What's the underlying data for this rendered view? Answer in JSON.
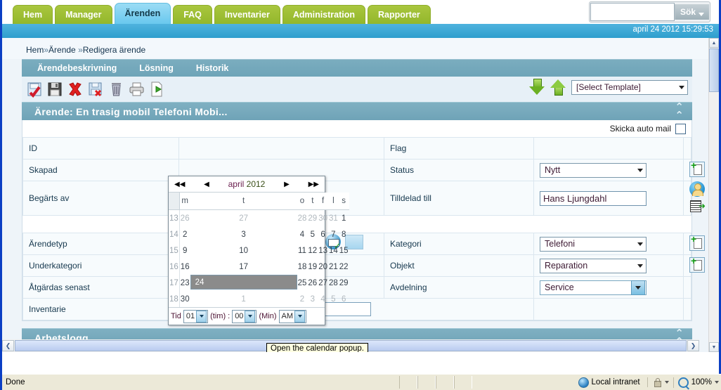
{
  "topnav": {
    "tabs": [
      {
        "label": "Hem",
        "active": false
      },
      {
        "label": "Manager",
        "active": false
      },
      {
        "label": "Ärenden",
        "active": true
      },
      {
        "label": "FAQ",
        "active": false
      },
      {
        "label": "Inventarier",
        "active": false
      },
      {
        "label": "Administration",
        "active": false
      },
      {
        "label": "Rapporter",
        "active": false
      }
    ],
    "search": {
      "value": "",
      "placeholder": "",
      "button_label": "Sök"
    },
    "datetime": "april 24 2012 15:29:53"
  },
  "breadcrumb": {
    "home": "Hem",
    "sep": "»",
    "level2": "Ärende",
    "level3": "Redigera ärende"
  },
  "subtabs": [
    {
      "label": "Ärendebeskrivning"
    },
    {
      "label": "Lösning"
    },
    {
      "label": "Historik"
    }
  ],
  "toolbar": {
    "icons": [
      {
        "name": "save-approve-icon"
      },
      {
        "name": "save-icon"
      },
      {
        "name": "cancel-icon"
      },
      {
        "name": "save-delete-icon"
      },
      {
        "name": "trash-icon"
      },
      {
        "name": "print-icon"
      },
      {
        "name": "run-page-icon"
      }
    ],
    "download_icon": "arrow-down-icon",
    "upload_icon": "arrow-up-icon",
    "template_select": "[Select Template]"
  },
  "case_panel": {
    "title": "Ärende: En trasig mobil Telefoni Mobi...",
    "collapse_icon": "chevron-up-icon",
    "auto_mail_label": "Skicka auto mail",
    "auto_mail_checked": false,
    "rows": [
      {
        "left_label": "ID",
        "left_value": "",
        "right_label": "Flag",
        "right_value": "",
        "right_control": "none"
      },
      {
        "left_label": "Skapad",
        "left_value": "",
        "right_label": "Status",
        "right_value": "Nytt",
        "right_control": "select"
      },
      {
        "left_label": "Begärts av",
        "left_value": "",
        "right_label": "Tilldelad till",
        "right_value": "Hans Ljungdahl",
        "right_control": "text"
      },
      {
        "left_label": "",
        "left_value": "",
        "right_label": "",
        "right_value": "",
        "right_control": "none"
      },
      {
        "left_label": "Ärendetyp",
        "left_value": "",
        "right_label": "Kategori",
        "right_value": "Telefoni",
        "right_control": "select"
      },
      {
        "left_label": "Underkategori",
        "left_value": "",
        "right_label": "Objekt",
        "right_value": "Reparation",
        "right_control": "select"
      },
      {
        "left_label": "Åtgärdas senast",
        "left_value": "",
        "right_label": "Avdelning",
        "right_value": "Service",
        "right_control": "select-blue"
      },
      {
        "left_label": "Inventarie",
        "left_value": "",
        "right_label": "",
        "right_value": "",
        "right_control": "none"
      }
    ]
  },
  "calendar": {
    "nav": {
      "prev_year": "◀◀",
      "prev_month": "◀",
      "next_month": "▶",
      "next_year": "▶▶"
    },
    "month": "april",
    "year": "2012",
    "weekday_headers": [
      "m",
      "t",
      "o",
      "t",
      "f",
      "l",
      "s"
    ],
    "week_numbers": [
      "13",
      "14",
      "15",
      "16",
      "17",
      "18"
    ],
    "weeks": [
      [
        {
          "d": "26",
          "off": true
        },
        {
          "d": "27",
          "off": true
        },
        {
          "d": "28",
          "off": true
        },
        {
          "d": "29",
          "off": true
        },
        {
          "d": "30",
          "off": true
        },
        {
          "d": "31",
          "off": true
        },
        {
          "d": "1",
          "off": false
        }
      ],
      [
        {
          "d": "2",
          "off": false
        },
        {
          "d": "3",
          "off": false
        },
        {
          "d": "4",
          "off": false
        },
        {
          "d": "5",
          "off": false
        },
        {
          "d": "6",
          "off": false
        },
        {
          "d": "7",
          "off": false
        },
        {
          "d": "8",
          "off": false
        }
      ],
      [
        {
          "d": "9",
          "off": false
        },
        {
          "d": "10",
          "off": false
        },
        {
          "d": "11",
          "off": false
        },
        {
          "d": "12",
          "off": false
        },
        {
          "d": "13",
          "off": false
        },
        {
          "d": "14",
          "off": false
        },
        {
          "d": "15",
          "off": false
        }
      ],
      [
        {
          "d": "16",
          "off": false
        },
        {
          "d": "17",
          "off": false
        },
        {
          "d": "18",
          "off": false
        },
        {
          "d": "19",
          "off": false
        },
        {
          "d": "20",
          "off": false
        },
        {
          "d": "21",
          "off": false
        },
        {
          "d": "22",
          "off": false
        }
      ],
      [
        {
          "d": "23",
          "off": false
        },
        {
          "d": "24",
          "off": false,
          "selected": true
        },
        {
          "d": "25",
          "off": false
        },
        {
          "d": "26",
          "off": false
        },
        {
          "d": "27",
          "off": false
        },
        {
          "d": "28",
          "off": false
        },
        {
          "d": "29",
          "off": false
        }
      ],
      [
        {
          "d": "30",
          "off": false
        },
        {
          "d": "1",
          "off": true
        },
        {
          "d": "2",
          "off": true
        },
        {
          "d": "3",
          "off": true
        },
        {
          "d": "4",
          "off": true
        },
        {
          "d": "5",
          "off": true
        },
        {
          "d": "6",
          "off": true
        }
      ]
    ],
    "time": {
      "label": "Tid",
      "hour": "01",
      "hour_unit": "(tim)",
      "separator": ":",
      "minute": "00",
      "minute_unit": "(Min)",
      "meridiem": "AM"
    }
  },
  "tooltip": {
    "text": "Open the calendar popup."
  },
  "worklog": {
    "title": "Arbetslogg",
    "collapse_icon": "chevron-up-icon"
  },
  "statusbar": {
    "status": "Done",
    "zone": "Local intranet",
    "zone_icon": "globe-icon",
    "security_icon": "lock-icon",
    "zoom": "100%",
    "zoom_icon": "magnifier-icon"
  },
  "scrollbars": {
    "vertical_up": "▲",
    "vertical_down": "▼",
    "horizontal_left": "❮",
    "horizontal_right": "❯"
  }
}
